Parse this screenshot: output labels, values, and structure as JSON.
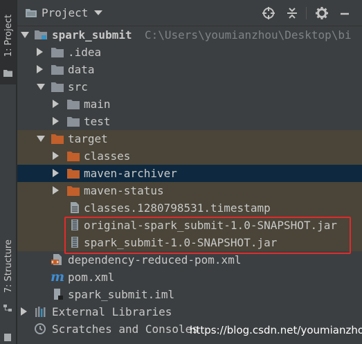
{
  "sidebar": {
    "project_tab": "1: Project",
    "structure_tab": "7: Structure"
  },
  "header": {
    "title": "Project"
  },
  "tree": {
    "root_name": "spark_submit",
    "root_path": "C:\\Users\\youmianzhou\\Desktop\\bi",
    "idea": ".idea",
    "data": "data",
    "src": "src",
    "main": "main",
    "test": "test",
    "target": "target",
    "classes": "classes",
    "maven_archiver": "maven-archiver",
    "maven_status": "maven-status",
    "timestamp_file": "classes.1280798531.timestamp",
    "original_jar": "original-spark_submit-1.0-SNAPSHOT.jar",
    "jar": "spark_submit-1.0-SNAPSHOT.jar",
    "dep_pom": "dependency-reduced-pom.xml",
    "pom": "pom.xml",
    "iml": "spark_submit.iml",
    "external_libraries": "External Libraries",
    "scratches": "Scratches and Consoles"
  },
  "watermark": "https://blog.csdn.net/youmianzhou",
  "colors": {
    "folder_gray": "#8a9199",
    "folder_orange": "#c25f2b",
    "accent_red": "#e02b2b",
    "selection": "#0e293f"
  }
}
